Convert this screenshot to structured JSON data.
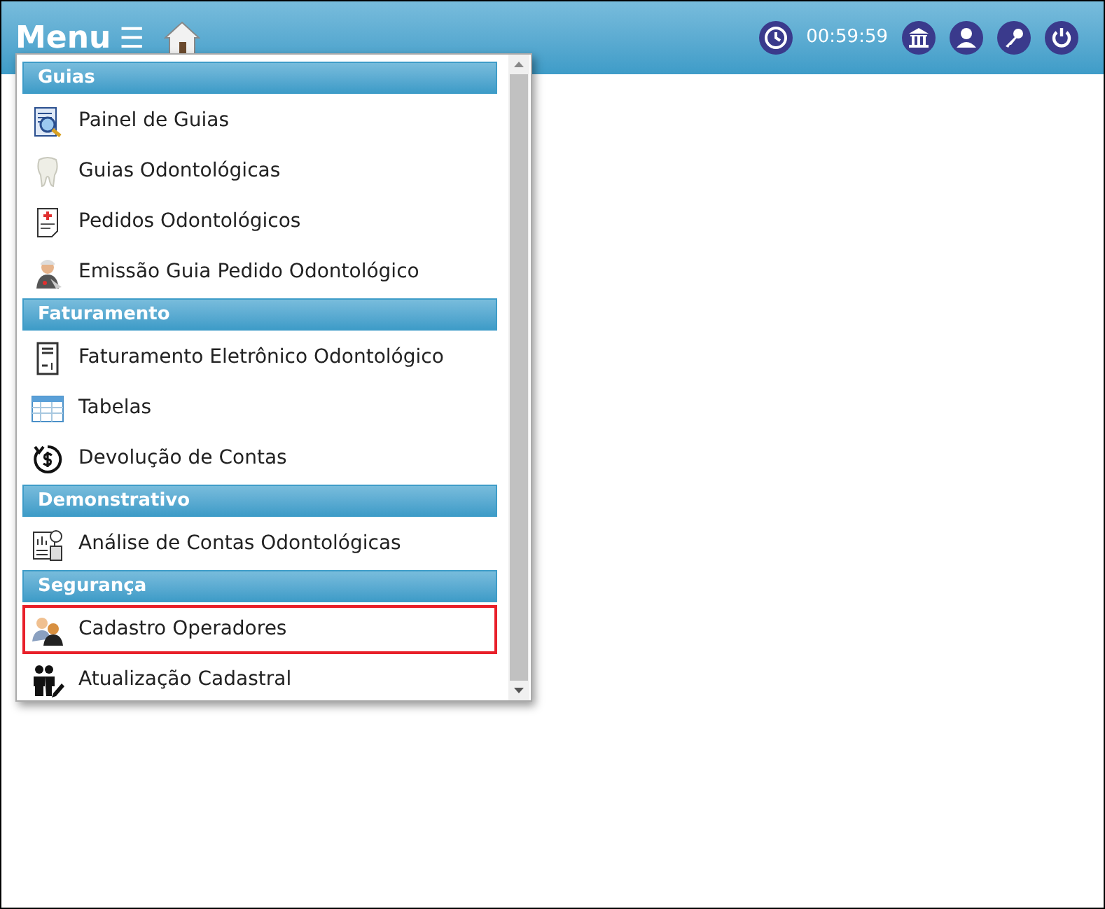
{
  "header": {
    "menu_label": "Menu",
    "hamburger": "☰",
    "timer": "00:59:59"
  },
  "sections": [
    {
      "title": "Guias",
      "items": [
        {
          "label": "Painel de Guias",
          "kind": "panel",
          "highlighted": false
        },
        {
          "label": "Guias Odontológicas",
          "kind": "tooth",
          "highlighted": false
        },
        {
          "label": "Pedidos Odontológicos",
          "kind": "order",
          "highlighted": false
        },
        {
          "label": "Emissão Guia Pedido Odontológico",
          "kind": "nurse",
          "highlighted": false
        }
      ]
    },
    {
      "title": "Faturamento",
      "items": [
        {
          "label": "Faturamento Eletrônico Odontológico",
          "kind": "invoice",
          "highlighted": false
        },
        {
          "label": "Tabelas",
          "kind": "table",
          "highlighted": false
        },
        {
          "label": "Devolução de Contas",
          "kind": "refund",
          "highlighted": false
        }
      ]
    },
    {
      "title": "Demonstrativo",
      "items": [
        {
          "label": "Análise de Contas Odontológicas",
          "kind": "analysis",
          "highlighted": false
        }
      ]
    },
    {
      "title": "Segurança",
      "items": [
        {
          "label": "Cadastro Operadores",
          "kind": "operators",
          "highlighted": true
        },
        {
          "label": "Atualização Cadastral",
          "kind": "update",
          "highlighted": false
        }
      ]
    }
  ]
}
